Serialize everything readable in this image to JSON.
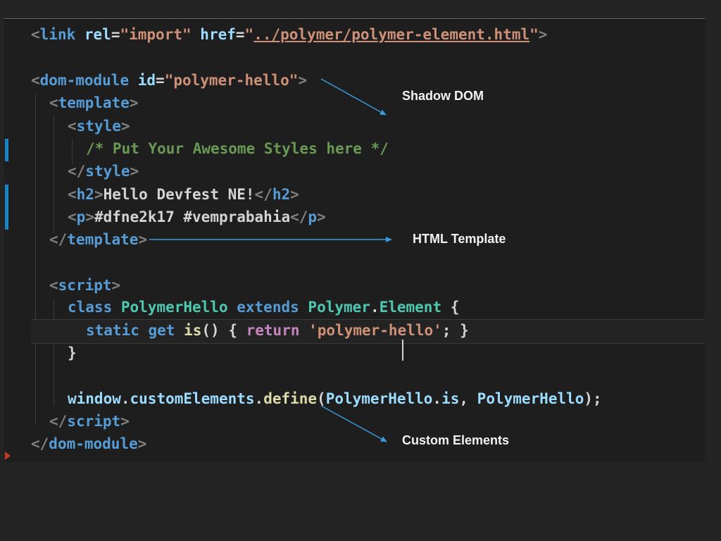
{
  "code": {
    "line1": {
      "open": "<",
      "tag": "link",
      "sp1": " ",
      "attr1": "rel",
      "eq1": "=",
      "val1": "\"import\"",
      "sp2": " ",
      "attr2": "href",
      "eq2": "=",
      "q1": "\"",
      "url": "../polymer/polymer-element.html",
      "q2": "\"",
      "close": ">"
    },
    "line2": {
      "open": "<",
      "tag": "dom-module",
      "sp1": " ",
      "attr": "id",
      "eq": "=",
      "val": "\"polymer-hello\"",
      "close": ">"
    },
    "line3": {
      "open": "<",
      "tag": "template",
      "close": ">"
    },
    "line4": {
      "open": "<",
      "tag": "style",
      "close": ">"
    },
    "line5": {
      "comment": "/* Put Your Awesome Styles here */"
    },
    "line6": {
      "open": "</",
      "tag": "style",
      "close": ">"
    },
    "line7": {
      "open": "<",
      "tag": "h2",
      "close": ">",
      "text": "Hello Devfest NE!",
      "open2": "</",
      "tag2": "h2",
      "close2": ">"
    },
    "line8": {
      "open": "<",
      "tag": "p",
      "close": ">",
      "text": "#dfne2k17 #vemprabahia",
      "open2": "</",
      "tag2": "p",
      "close2": ">"
    },
    "line9": {
      "open": "</",
      "tag": "template",
      "close": ">"
    },
    "line10": {
      "open": "<",
      "tag": "script",
      "close": ">"
    },
    "line11": {
      "kw": "class",
      "sp1": " ",
      "cls": "PolymerHello",
      "sp2": " ",
      "kw2": "extends",
      "sp3": " ",
      "cls2": "Polymer",
      "dot": ".",
      "cls3": "Element",
      "brace": " {"
    },
    "line12": {
      "kw": "static",
      "sp1": " ",
      "kw2": "get",
      "sp2": " ",
      "fn": "is",
      "paren": "() { ",
      "ctl": "return",
      "sp3": " ",
      "str": "'polymer-hello'",
      "end": "; }"
    },
    "line13": {
      "brace": "}"
    },
    "line14": {
      "var1": "window",
      "dot1": ".",
      "var2": "customElements",
      "dot2": ".",
      "fn": "define",
      "p1": "(",
      "var3": "PolymerHello",
      "dot3": ".",
      "var4": "is",
      "comma": ", ",
      "var5": "PolymerHello",
      "p2": ");"
    },
    "line15": {
      "open": "</",
      "tag": "script",
      "close": ">"
    },
    "line16": {
      "open": "</",
      "tag": "dom-module",
      "close": ">"
    }
  },
  "annotations": {
    "shadow_dom": "Shadow DOM",
    "html_template": "HTML Template",
    "custom_elements": "Custom Elements"
  },
  "colors": {
    "background": "#242424",
    "editor_background": "#1e1e1e",
    "arrow": "#3a9ad9",
    "tag": "#569cd6",
    "string": "#ce9178",
    "comment": "#6a9955",
    "class_name": "#4ec9b0",
    "function": "#dcdcaa",
    "keyword_control": "#c586c0",
    "variable": "#9cdcfe"
  }
}
